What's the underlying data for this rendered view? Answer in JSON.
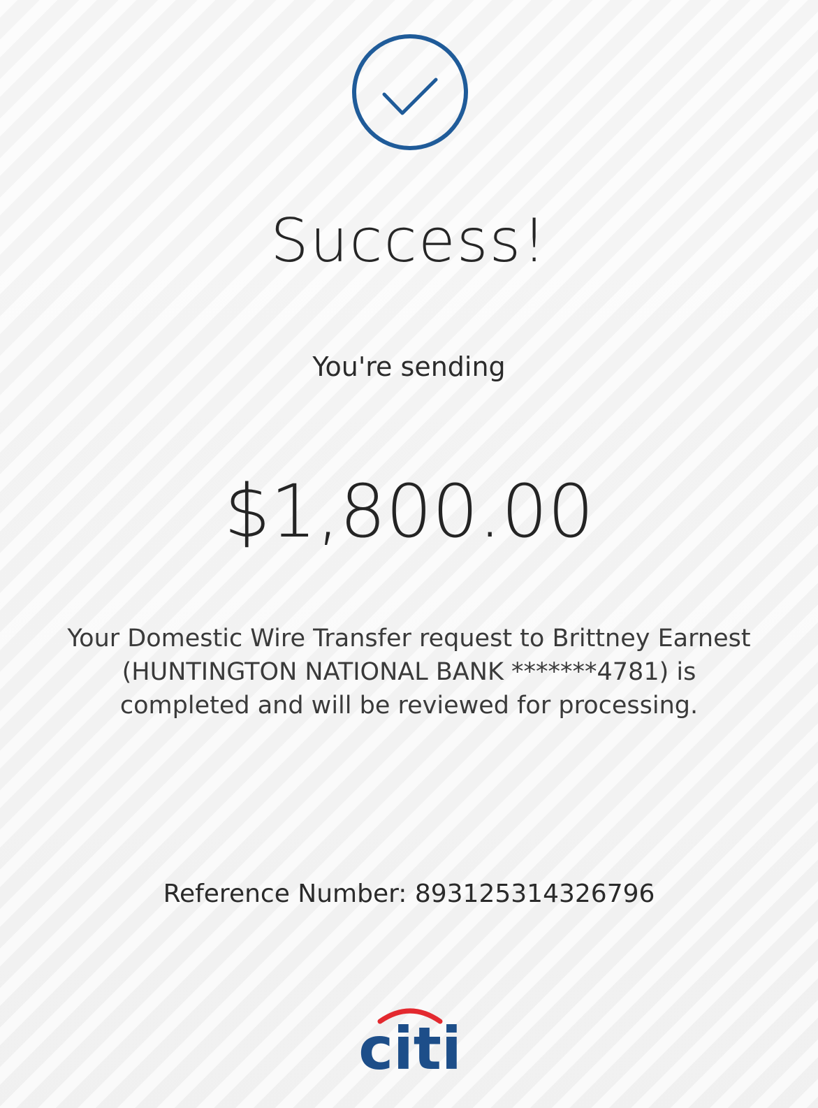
{
  "status": {
    "title": "Success!",
    "subtitle": "You're sending"
  },
  "transfer": {
    "amount": "$1,800.00",
    "message": "Your Domestic Wire Transfer request to Brittney Earnest (HUNTINGTON NATIONAL BANK *******4781) is completed and will be reviewed for processing.",
    "reference": "Reference Number: 893125314326796"
  },
  "brand": {
    "logo_text": "citi",
    "primary_color": "#1d4e89",
    "accent_color": "#e3292f"
  },
  "icons": {
    "success": "check-circle-icon"
  }
}
